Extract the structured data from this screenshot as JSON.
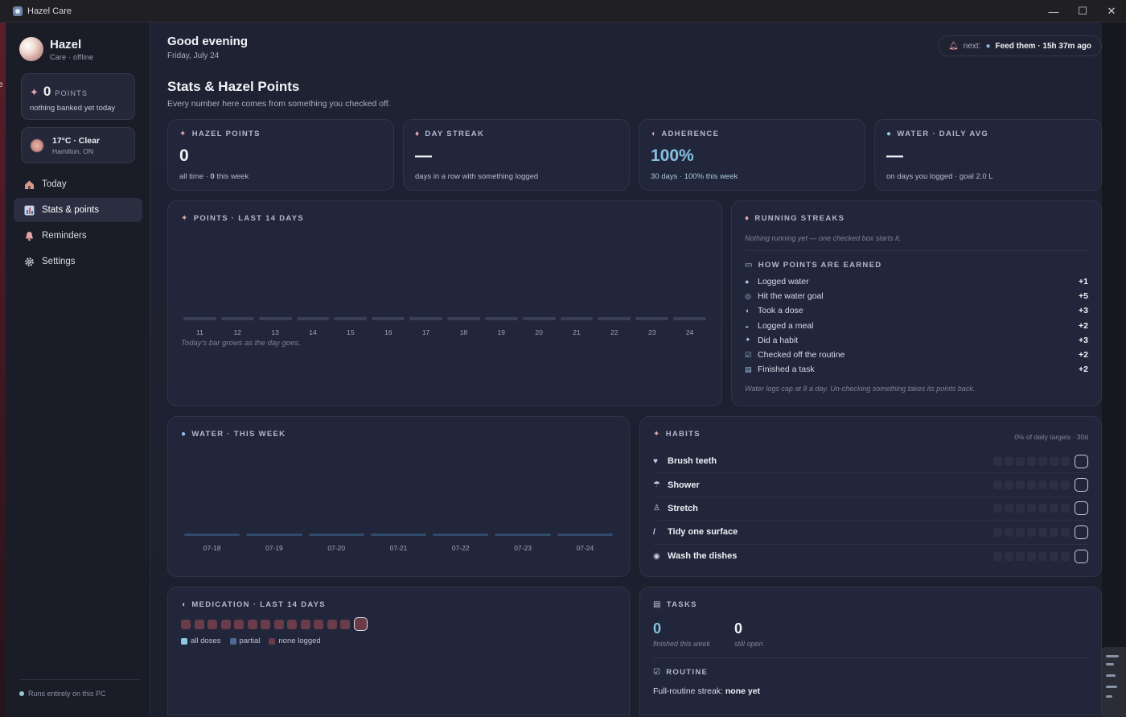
{
  "window": {
    "title": "Hazel Care",
    "minimize": "—",
    "maximize": "☐",
    "close": "✕"
  },
  "outer": {
    "fragment": "e"
  },
  "sidebar": {
    "name": "Hazel",
    "status": "Care · offline",
    "points": {
      "value": "0",
      "label": "POINTS",
      "sub": "nothing banked yet today"
    },
    "weather": {
      "title": "17°C · Clear",
      "location": "Hamilton, ON"
    },
    "nav": [
      {
        "label": "Today",
        "icon": "house-icon"
      },
      {
        "label": "Stats & points",
        "icon": "bar-chart-icon"
      },
      {
        "label": "Reminders",
        "icon": "bell-icon"
      },
      {
        "label": "Settings",
        "icon": "gear-icon"
      }
    ],
    "footer": "Runs entirely on this PC"
  },
  "header": {
    "greeting": "Good evening",
    "date": "Friday, July 24",
    "next_label": "next:",
    "next_value": "Feed them · 15h 37m ago"
  },
  "section": {
    "title": "Stats & Hazel Points",
    "subtitle": "Every number here comes from something you checked off."
  },
  "stats": {
    "points": {
      "label": "HAZEL POINTS",
      "value": "0",
      "sub_prefix": "all time · ",
      "sub_bold": "0",
      "sub_suffix": " this week"
    },
    "streak": {
      "label": "DAY STREAK",
      "value": "—",
      "sub": "days in a row with something logged"
    },
    "adherence": {
      "label": "ADHERENCE",
      "value": "100%",
      "sub": "30 days · 100% this week"
    },
    "water": {
      "label": "WATER · DAILY AVG",
      "value": "—",
      "sub": "on days you logged · goal 2.0 L"
    }
  },
  "points_chart": {
    "title": "POINTS · LAST 14 DAYS",
    "note": "Today's bar grows as the day goes."
  },
  "streaks": {
    "title": "RUNNING STREAKS",
    "empty": "Nothing running yet — one checked box starts it.",
    "earn_title": "HOW POINTS ARE EARNED",
    "earn": [
      {
        "label": "Logged water",
        "pts": "+1",
        "icon": "droplet-icon"
      },
      {
        "label": "Hit the water goal",
        "pts": "+5",
        "icon": "target-icon"
      },
      {
        "label": "Took a dose",
        "pts": "+3",
        "icon": "pill-icon"
      },
      {
        "label": "Logged a meal",
        "pts": "+2",
        "icon": "bowl-icon"
      },
      {
        "label": "Did a habit",
        "pts": "+3",
        "icon": "sparkle-icon"
      },
      {
        "label": "Checked off the routine",
        "pts": "+2",
        "icon": "checkbox-icon"
      },
      {
        "label": "Finished a task",
        "pts": "+2",
        "icon": "clipboard-icon"
      }
    ],
    "note": "Water logs cap at 8 a day. Un-checking something takes its points back."
  },
  "water_chart": {
    "title": "WATER · THIS WEEK"
  },
  "habits": {
    "title": "HABITS",
    "meta": "0% of daily targets · 30d",
    "items": [
      {
        "label": "Brush teeth",
        "icon": "tooth-icon"
      },
      {
        "label": "Shower",
        "icon": "shower-icon"
      },
      {
        "label": "Stretch",
        "icon": "stretch-icon"
      },
      {
        "label": "Tidy one surface",
        "icon": "broom-icon"
      },
      {
        "label": "Wash the dishes",
        "icon": "dish-icon"
      }
    ]
  },
  "medication": {
    "title": "MEDICATION · LAST 14 DAYS",
    "legend": [
      {
        "label": "all doses",
        "color": "#8fc9e0"
      },
      {
        "label": "partial",
        "color": "#4d6a94"
      },
      {
        "label": "none logged",
        "color": "#6a3c4a"
      }
    ]
  },
  "tasks": {
    "title": "TASKS",
    "finished": "0",
    "finished_label": "finished this week",
    "open": "0",
    "open_label": "still open",
    "routine_title": "ROUTINE",
    "routine_text": "Full-routine streak: ",
    "routine_value": "none yet"
  },
  "chart_data": [
    {
      "type": "bar",
      "title": "POINTS · LAST 14 DAYS",
      "categories": [
        "11",
        "12",
        "13",
        "14",
        "15",
        "16",
        "17",
        "18",
        "19",
        "20",
        "21",
        "22",
        "23",
        "24"
      ],
      "values": [
        0,
        0,
        0,
        0,
        0,
        0,
        0,
        0,
        0,
        0,
        0,
        0,
        0,
        0
      ],
      "grid": false
    },
    {
      "type": "bar",
      "title": "WATER · THIS WEEK",
      "categories": [
        "07-18",
        "07-19",
        "07-20",
        "07-21",
        "07-22",
        "07-23",
        "07-24"
      ],
      "values": [
        0,
        0,
        0,
        0,
        0,
        0,
        0
      ],
      "grid": false
    }
  ],
  "colors": {
    "accent": "#86c1e3",
    "card": "#22263a",
    "sidebar": "#1a1c27",
    "pink": "#e6a7b0"
  }
}
